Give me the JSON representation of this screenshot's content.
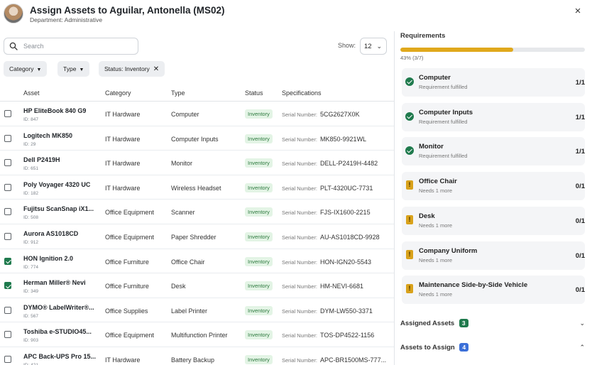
{
  "header": {
    "title": "Assign Assets to Aguilar, Antonella (MS02)",
    "department": "Department: Administrative",
    "close_symbol": "×"
  },
  "toolbar": {
    "search_placeholder": "Search",
    "show_label": "Show:",
    "show_value": "12"
  },
  "filters": [
    {
      "label": "Category",
      "type": "dropdown"
    },
    {
      "label": "Type",
      "type": "dropdown"
    },
    {
      "label": "Status: Inventory",
      "type": "removable"
    }
  ],
  "table": {
    "headers": [
      "Asset",
      "Category",
      "Type",
      "Status",
      "Specifications"
    ],
    "rows": [
      {
        "name": "HP EliteBook 840 G9",
        "id": "ID: 847",
        "category": "IT Hardware",
        "type": "Computer",
        "status": "Inventory",
        "spec_key": "Serial Number:",
        "spec_val": "5CG2627X0K",
        "checked": false
      },
      {
        "name": "Logitech MK850",
        "id": "ID: 29",
        "category": "IT Hardware",
        "type": "Computer Inputs",
        "status": "Inventory",
        "spec_key": "Serial Number:",
        "spec_val": "MK850-9921WL",
        "checked": false
      },
      {
        "name": "Dell P2419H",
        "id": "ID: 651",
        "category": "IT Hardware",
        "type": "Monitor",
        "status": "Inventory",
        "spec_key": "Serial Number:",
        "spec_val": "DELL-P2419H-4482",
        "checked": false
      },
      {
        "name": "Poly Voyager 4320 UC",
        "id": "ID: 182",
        "category": "IT Hardware",
        "type": "Wireless Headset",
        "status": "Inventory",
        "spec_key": "Serial Number:",
        "spec_val": "PLT-4320UC-7731",
        "checked": false
      },
      {
        "name": "Fujitsu ScanSnap iX1...",
        "id": "ID: 508",
        "category": "Office Equipment",
        "type": "Scanner",
        "status": "Inventory",
        "spec_key": "Serial Number:",
        "spec_val": "FJS-IX1600-2215",
        "checked": false
      },
      {
        "name": "Aurora AS1018CD",
        "id": "ID: 912",
        "category": "Office Equipment",
        "type": "Paper Shredder",
        "status": "Inventory",
        "spec_key": "Serial Number:",
        "spec_val": "AU-AS1018CD-9928",
        "checked": false
      },
      {
        "name": "HON Ignition 2.0",
        "id": "ID: 774",
        "category": "Office Furniture",
        "type": "Office Chair",
        "status": "Inventory",
        "spec_key": "Serial Number:",
        "spec_val": "HON-IGN20-5543",
        "checked": true
      },
      {
        "name": "Herman Miller® Nevi",
        "id": "ID: 349",
        "category": "Office Furniture",
        "type": "Desk",
        "status": "Inventory",
        "spec_key": "Serial Number:",
        "spec_val": "HM-NEVI-6681",
        "checked": true
      },
      {
        "name": "DYMO® LabelWriter®...",
        "id": "ID: 567",
        "category": "Office Supplies",
        "type": "Label Printer",
        "status": "Inventory",
        "spec_key": "Serial Number:",
        "spec_val": "DYM-LW550-3371",
        "checked": false
      },
      {
        "name": "Toshiba e-STUDIO45...",
        "id": "ID: 903",
        "category": "Office Equipment",
        "type": "Multifunction Printer",
        "status": "Inventory",
        "spec_key": "Serial Number:",
        "spec_val": "TOS-DP4522-1156",
        "checked": false
      },
      {
        "name": "APC Back-UPS Pro 15...",
        "id": "ID: 421",
        "category": "IT Hardware",
        "type": "Battery Backup",
        "status": "Inventory",
        "spec_key": "Serial Number:",
        "spec_val": "APC-BR1500MS-777...",
        "checked": false
      }
    ]
  },
  "requirements": {
    "title": "Requirements",
    "progress_fraction": 0.61,
    "progress_text": "43% (3/7)",
    "items": [
      {
        "name": "Computer",
        "status": "Requirement fulfilled",
        "count": "1/1",
        "state": "fulfilled"
      },
      {
        "name": "Computer Inputs",
        "status": "Requirement fulfilled",
        "count": "1/1",
        "state": "fulfilled"
      },
      {
        "name": "Monitor",
        "status": "Requirement fulfilled",
        "count": "1/1",
        "state": "fulfilled"
      },
      {
        "name": "Office Chair",
        "status": "Needs 1 more",
        "count": "0/1",
        "state": "needed"
      },
      {
        "name": "Desk",
        "status": "Needs 1 more",
        "count": "0/1",
        "state": "needed"
      },
      {
        "name": "Company Uniform",
        "status": "Needs 1 more",
        "count": "0/1",
        "state": "needed"
      },
      {
        "name": "Maintenance Side-by-Side Vehicle",
        "status": "Needs 1 more",
        "count": "0/1",
        "state": "needed"
      }
    ]
  },
  "assigned_assets": {
    "label": "Assigned Assets",
    "count": "3",
    "color": "#1f7a4d"
  },
  "assets_to_assign": {
    "label": "Assets to Assign",
    "count": "4",
    "color": "#3b6fd8"
  },
  "colors": {
    "accent_green": "#1f7a4d",
    "progress_yellow": "#e0a81c",
    "badge_bg": "#e3f4e5",
    "badge_text": "#2e7a3f"
  }
}
